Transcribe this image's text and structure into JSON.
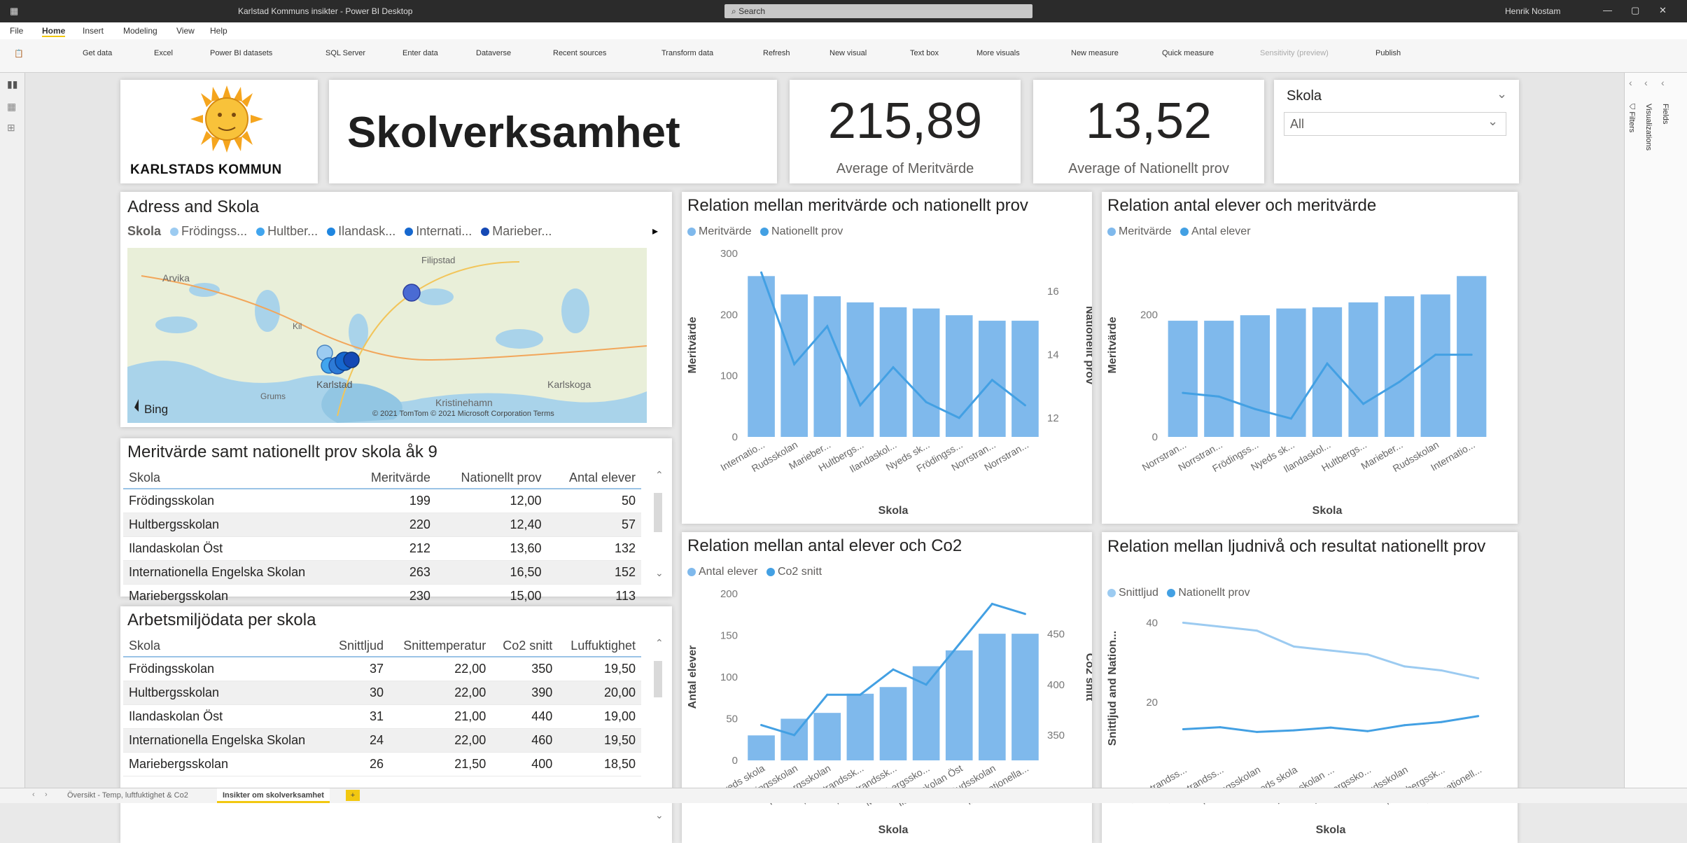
{
  "app": {
    "title": "Karlstad Kommuns insikter - Power BI Desktop",
    "search_placeholder": "Search",
    "user": "Henrik Nostam"
  },
  "menu": [
    "File",
    "Home",
    "Insert",
    "Modeling",
    "View",
    "Help"
  ],
  "ribbon": [
    "Get data",
    "Excel",
    "Power BI datasets",
    "SQL Server",
    "Enter data",
    "Dataverse",
    "Recent sources",
    "Transform data",
    "Refresh",
    "New visual",
    "Text box",
    "More visuals",
    "New measure",
    "Quick measure",
    "Sensitivity (preview)",
    "Publish"
  ],
  "panes": {
    "filters": "Filters",
    "visualizations": "Visualizations",
    "fields": "Fields"
  },
  "logo": {
    "text": "KARLSTADS KOMMUN"
  },
  "page_title": "Skolverksamhet",
  "kpi": [
    {
      "value": "215,89",
      "label": "Average of Meritvärde"
    },
    {
      "value": "13,52",
      "label": "Average of Nationellt prov"
    }
  ],
  "slicer": {
    "title": "Skola",
    "value": "All"
  },
  "map": {
    "title": "Adress and Skola",
    "legend_title": "Skola",
    "legend": [
      "Frödingss...",
      "Hultber...",
      "Ilandask...",
      "Internati...",
      "Marieber..."
    ],
    "places": [
      "Filipstad",
      "Arvika",
      "Kil",
      "Grums",
      "Karlstad",
      "Kristinehamn",
      "Karlskoga"
    ],
    "bing": "Bing",
    "copyright": "© 2021 TomTom  © 2021 Microsoft Corporation  Terms"
  },
  "table1": {
    "title": "Meritvärde samt nationellt prov skola åk 9",
    "headers": [
      "Skola",
      "Meritvärde",
      "Nationellt prov",
      "Antal elever"
    ],
    "rows": [
      [
        "Frödingsskolan",
        "199",
        "12,00",
        "50"
      ],
      [
        "Hultbergsskolan",
        "220",
        "12,40",
        "57"
      ],
      [
        "Ilandaskolan Öst",
        "212",
        "13,60",
        "132"
      ],
      [
        "Internationella Engelska Skolan",
        "263",
        "16,50",
        "152"
      ],
      [
        "Mariebergsskolan",
        "230",
        "15,00",
        "113"
      ]
    ]
  },
  "table2": {
    "title": "Arbetsmiljödata per skola",
    "headers": [
      "Skola",
      "Snittljud",
      "Snittemperatur",
      "Co2 snitt",
      "Luffuktighet"
    ],
    "rows": [
      [
        "Frödingsskolan",
        "37",
        "22,00",
        "350",
        "19,50"
      ],
      [
        "Hultbergsskolan",
        "30",
        "22,00",
        "390",
        "20,00"
      ],
      [
        "Ilandaskolan Öst",
        "31",
        "21,00",
        "440",
        "19,00"
      ],
      [
        "Internationella Engelska Skolan",
        "24",
        "22,00",
        "460",
        "19,50"
      ],
      [
        "Mariebergsskolan",
        "26",
        "21,50",
        "400",
        "18,50"
      ]
    ]
  },
  "chart_data": [
    {
      "type": "bar",
      "title": "Relation mellan meritvärde och nationellt prov",
      "legend": [
        "Meritvärde",
        "Nationellt prov"
      ],
      "categories": [
        "Internatio...",
        "Rudsskolan",
        "Marieber...",
        "Hultbergs...",
        "Ilandaskol...",
        "Nyeds sk...",
        "Frödingss...",
        "Norrstran...",
        "Norrstran..."
      ],
      "series": [
        {
          "name": "Meritvärde",
          "kind": "bar",
          "axis": "left",
          "values": [
            263,
            233,
            230,
            220,
            212,
            210,
            199,
            190,
            190
          ]
        },
        {
          "name": "Nationellt prov",
          "kind": "line",
          "axis": "right",
          "values": [
            16.6,
            13.7,
            14.9,
            12.4,
            13.6,
            12.5,
            12.0,
            13.2,
            12.4
          ]
        }
      ],
      "xlabel": "Skola",
      "ylabel": "Meritvärde",
      "y2label": "Nationellt prov",
      "ylim": [
        0,
        300
      ],
      "y2lim": [
        11.4,
        17.2
      ],
      "yticks": [
        "0",
        "100",
        "200",
        "300"
      ],
      "y2ticks": [
        "12",
        "14",
        "16"
      ],
      "color": "#7fb9ec",
      "line_color": "#43a0e3"
    },
    {
      "type": "bar",
      "title": "Relation antal elever och meritvärde",
      "legend": [
        "Meritvärde",
        "Antal elever"
      ],
      "categories": [
        "Norrstran...",
        "Norrstran...",
        "Frödingss...",
        "Nyeds sk...",
        "Ilandaskol...",
        "Hultbergs...",
        "Marieber...",
        "Rudsskolan",
        "Internatio..."
      ],
      "series": [
        {
          "name": "Meritvärde",
          "kind": "bar",
          "axis": "left",
          "values": [
            190,
            190,
            199,
            210,
            212,
            220,
            230,
            233,
            263
          ]
        },
        {
          "name": "Antal elever",
          "kind": "line",
          "axis": "right",
          "values": [
            60,
            55,
            38,
            25,
            100,
            45,
            75,
            112,
            112
          ]
        }
      ],
      "xlabel": "Skola",
      "ylabel": "Meritvärde",
      "y2label": "",
      "ylim": [
        0,
        300
      ],
      "y2lim": [
        0,
        250
      ],
      "yticks": [
        "0",
        "200"
      ],
      "y2ticks": [],
      "color": "#7fb9ec",
      "line_color": "#43a0e3"
    },
    {
      "type": "bar",
      "title": "Relation mellan antal elever och Co2",
      "legend": [
        "Antal elever",
        "Co2 snitt"
      ],
      "categories": [
        "Nyeds skola",
        "Frödingsskolan",
        "Hultbergsskolan",
        "Norrstrandssk...",
        "Norrstrandssk...",
        "Mariebergssko...",
        "Ilandaskolan Öst",
        "Rudsskolan",
        "Internationella..."
      ],
      "series": [
        {
          "name": "Antal elever",
          "kind": "bar",
          "axis": "left",
          "values": [
            30,
            50,
            57,
            80,
            88,
            113,
            132,
            152,
            152
          ]
        },
        {
          "name": "Co2 snitt",
          "kind": "line",
          "axis": "right",
          "values": [
            360,
            350,
            390,
            390,
            415,
            400,
            440,
            480,
            470
          ]
        }
      ],
      "xlabel": "Skola",
      "ylabel": "Antal elever",
      "y2label": "Co2 snitt",
      "ylim": [
        0,
        200
      ],
      "y2lim": [
        325,
        490
      ],
      "yticks": [
        "0",
        "50",
        "100",
        "150",
        "200"
      ],
      "y2ticks": [
        "350",
        "400",
        "450"
      ],
      "color": "#7fb9ec",
      "line_color": "#43a0e3"
    },
    {
      "type": "line",
      "title": "Relation mellan ljudnivå och resultat nationellt prov",
      "legend": [
        "Snittljud",
        "Nationellt prov"
      ],
      "categories": [
        "Norrstrandss...",
        "Norrstrandss...",
        "Frödingsskolan",
        "Nyeds skola",
        "Ilandaskolan ...",
        "Hultbergssko...",
        "Rudsskolan",
        "Mariebergssk...",
        "Internationell..."
      ],
      "series": [
        {
          "name": "Snittljud",
          "kind": "line",
          "values": [
            40,
            39,
            38,
            34,
            33,
            32,
            29,
            28,
            26
          ]
        },
        {
          "name": "Nationellt prov",
          "kind": "line",
          "values": [
            13.2,
            13.7,
            12.5,
            12.9,
            13.6,
            12.7,
            14.2,
            15.0,
            16.5
          ]
        }
      ],
      "xlabel": "Skola",
      "ylabel": "Snittljud and Nation...",
      "ylim": [
        5,
        42
      ],
      "yticks": [
        "20",
        "40"
      ],
      "colors": [
        "#9ccbf1",
        "#43a0e3"
      ]
    }
  ],
  "tabs": [
    "Översikt - Temp, luftfuktighet & Co2",
    "Insikter om skolverksamhet"
  ],
  "colors": {
    "accent": "#118dff",
    "bar": "#7fb9ec",
    "line": "#43a0e3",
    "map_water": "#a9d3ea",
    "map_land": "#e9efd9"
  }
}
